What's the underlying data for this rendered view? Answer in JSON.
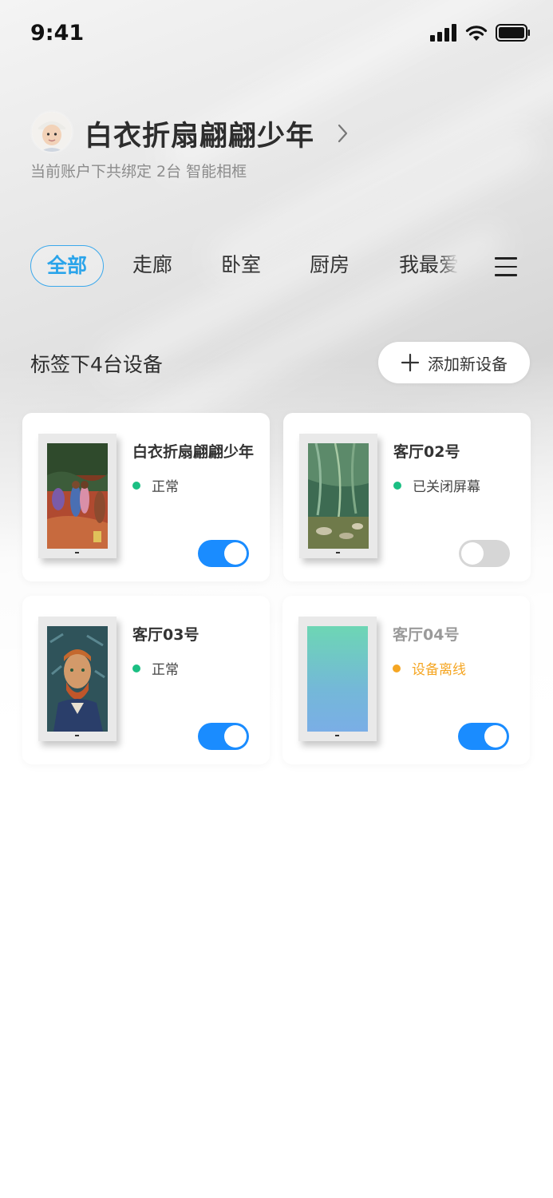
{
  "status_bar": {
    "time": "9:41"
  },
  "profile": {
    "user_name": "白衣折扇翩翩少年",
    "account_info": "当前账户下共绑定 2台 智能相框"
  },
  "tabs": [
    {
      "label": "全部",
      "active": true
    },
    {
      "label": "走廊",
      "active": false
    },
    {
      "label": "卧室",
      "active": false
    },
    {
      "label": "厨房",
      "active": false
    },
    {
      "label": "我最爱",
      "active": false
    }
  ],
  "section": {
    "title": "标签下4台设备",
    "add_button_label": "添加新设备"
  },
  "devices": [
    {
      "name": "白衣折扇翩翩少年",
      "status": "正常",
      "status_color": "#1bbf83",
      "enabled": true
    },
    {
      "name": "客厅02号",
      "status": "已关闭屏幕",
      "status_color": "#1bbf83",
      "enabled": false
    },
    {
      "name": "客厅03号",
      "status": "正常",
      "status_color": "#1bbf83",
      "enabled": true
    },
    {
      "name": "客厅04号",
      "status": "设备离线",
      "status_color": "#f5a623",
      "enabled": true
    }
  ],
  "colors": {
    "accent": "#1a8cff",
    "tab_active": "#2aa4ea",
    "status_ok": "#1bbf83",
    "status_offline": "#f5a623"
  }
}
